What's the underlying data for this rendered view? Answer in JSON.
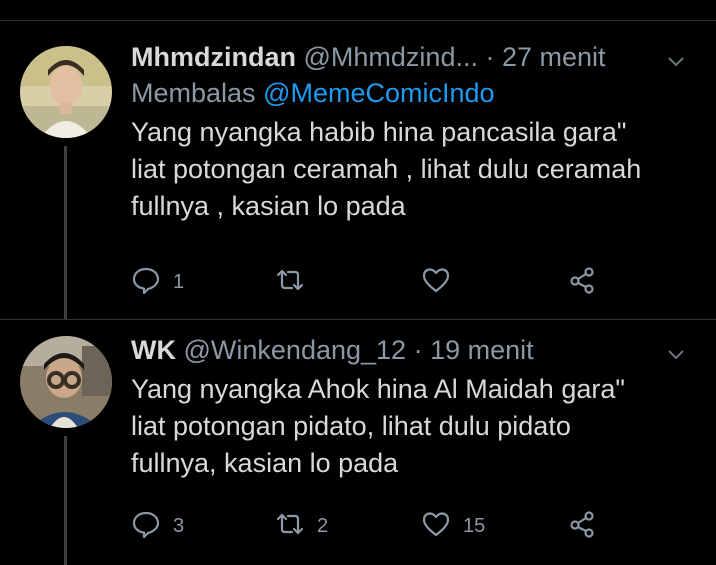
{
  "tweets": [
    {
      "name": "Mhmdzindan",
      "handle": "@Mhmdzind...",
      "dot": "·",
      "time": "27 menit",
      "replying_prefix": "Membalas",
      "replying_to": "@MemeComicIndo",
      "text": "Yang nyangka habib hina pancasila gara\"\nliat potongan ceramah , lihat dulu ceramah\nfullnya , kasian lo pada",
      "reply_count": "1",
      "retweet_count": "",
      "like_count": ""
    },
    {
      "name": "WK",
      "handle": "@Winkendang_12",
      "dot": "·",
      "time": "19 menit",
      "text": "Yang nyangka Ahok hina Al Maidah gara\"\nliat potongan pidato, lihat dulu pidato\nfullnya, kasian lo pada",
      "reply_count": "3",
      "retweet_count": "2",
      "like_count": "15"
    }
  ],
  "colors": {
    "background": "#000000",
    "text": "#d9d9d9",
    "secondary": "#8b98a5",
    "link": "#1d9bf0",
    "thread_line": "#3d4145"
  },
  "icons": [
    "reply-icon",
    "retweet-icon",
    "like-icon",
    "share-icon",
    "chevron-down-icon"
  ]
}
